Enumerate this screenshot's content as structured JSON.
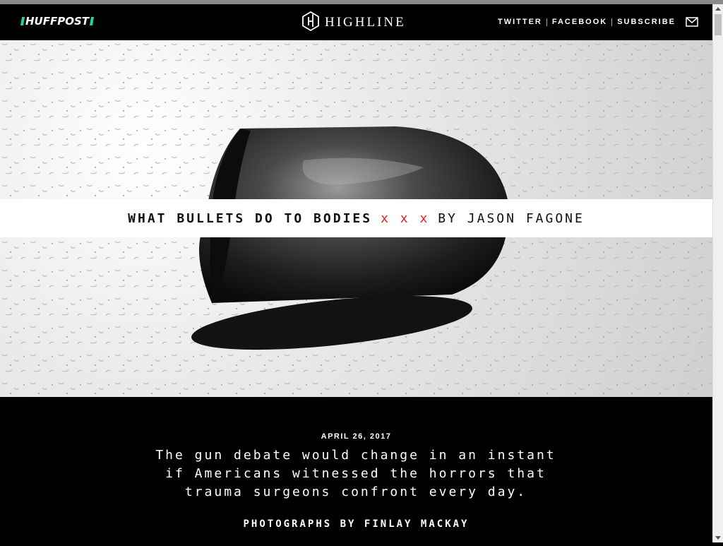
{
  "header": {
    "brand": "HUFFPOST",
    "section_title": "HIGHLINE",
    "nav": [
      {
        "label": "TWITTER"
      },
      {
        "label": "FACEBOOK"
      },
      {
        "label": "SUBSCRIBE"
      }
    ],
    "icons": {
      "highline_logo": "highline-hex-logo-icon",
      "mail": "mail-icon"
    },
    "accent_color": "#1fd4a3"
  },
  "hero": {
    "title": "WHAT BULLETS DO TO BODIES",
    "separator": "x x x",
    "byline": "BY JASON FAGONE",
    "separator_color": "#e0231b"
  },
  "article": {
    "date": "APRIL 26, 2017",
    "dek": "The gun debate would change in an instant if Americans witnessed the horrors that trauma surgeons confront every day.",
    "photo_credit": "PHOTOGRAPHS BY FINLAY MACKAY"
  }
}
